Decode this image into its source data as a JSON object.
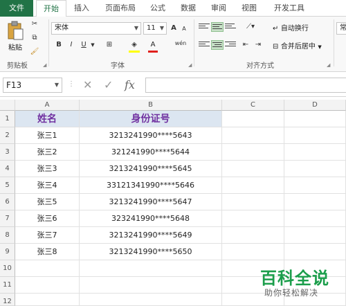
{
  "tabs": [
    "文件",
    "开始",
    "插入",
    "页面布局",
    "公式",
    "数据",
    "审阅",
    "视图",
    "开发工具"
  ],
  "ribbon": {
    "clipboard": {
      "paste_label": "粘贴",
      "group_label": "剪贴板"
    },
    "font": {
      "font_name": "宋体",
      "font_size": "11",
      "bold": "B",
      "italic": "I",
      "underline": "U",
      "group_label": "字体",
      "grow": "A",
      "shrink": "A",
      "font_color": "A",
      "wen": "wén"
    },
    "alignment": {
      "wrap_text": "自动换行",
      "merge_center": "合并后居中",
      "group_label": "对齐方式"
    },
    "number": {
      "format": "常"
    }
  },
  "formula_bar": {
    "name_box": "F13",
    "fx": "fx",
    "cancel": "✕",
    "enter": "✓",
    "formula": ""
  },
  "columns": [
    "A",
    "B",
    "C",
    "D"
  ],
  "rows": [
    "1",
    "2",
    "3",
    "4",
    "5",
    "6",
    "7",
    "8",
    "9",
    "10",
    "11",
    "12"
  ],
  "table": {
    "headers": [
      "姓名",
      "身份证号"
    ],
    "data": [
      [
        "张三1",
        "3213241990****5643"
      ],
      [
        "张三2",
        "321241990****5644"
      ],
      [
        "张三3",
        "3213241990****5645"
      ],
      [
        "张三4",
        "33121341990****5646"
      ],
      [
        "张三5",
        "3213241990****5647"
      ],
      [
        "张三6",
        "323241990****5648"
      ],
      [
        "张三7",
        "3213241990****5649"
      ],
      [
        "张三8",
        "3213241990****5650"
      ]
    ]
  },
  "watermark": {
    "title": "百科全说",
    "subtitle": "助你轻松解决"
  },
  "colors": {
    "accent": "#217346",
    "header_fill": "#dce6f1",
    "header_text": "#7030a0"
  }
}
